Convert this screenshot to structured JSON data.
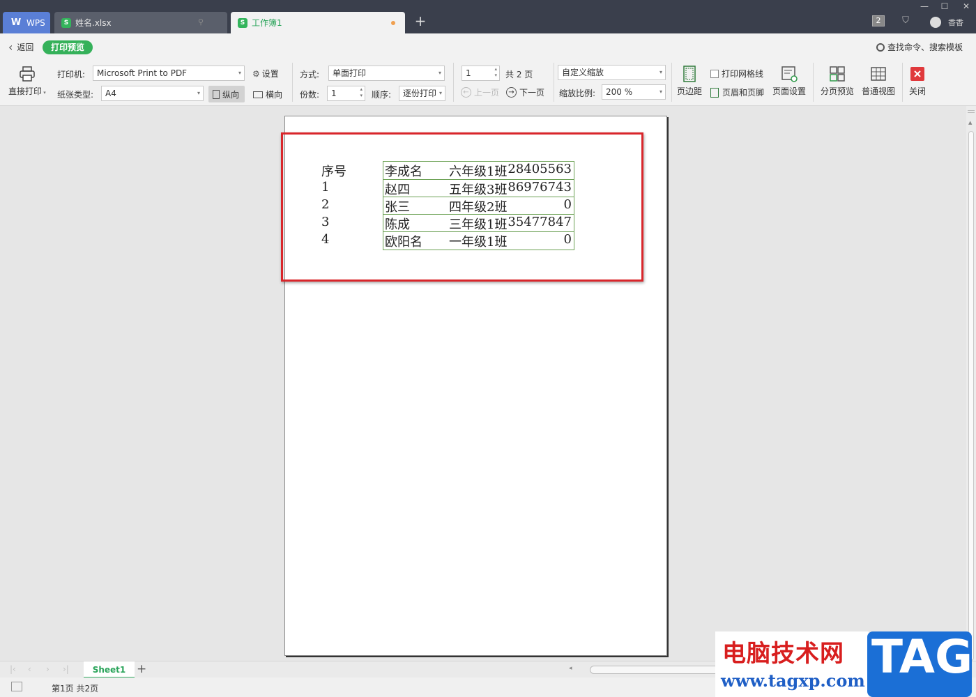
{
  "window": {
    "tabs": [
      {
        "label": "WPS",
        "icon": "wps-logo-icon"
      },
      {
        "label": "姓名.xlsx",
        "icon": "spreadsheet-icon"
      },
      {
        "label": "工作簿1",
        "icon": "spreadsheet-icon",
        "active": true
      }
    ],
    "new_tab_label": "+",
    "tab_count_badge": "2",
    "user_name": "香香",
    "minimize": "—",
    "maximize": "☐",
    "close": "✕"
  },
  "header": {
    "back_label": "返回",
    "mode_label": "打印预览",
    "search_label": "查找命令、搜索模板"
  },
  "toolbar": {
    "direct_print": "直接打印",
    "printer_label": "打印机:",
    "printer_value": "Microsoft Print to PDF",
    "settings": "设置",
    "paper_label": "纸张类型:",
    "paper_value": "A4",
    "portrait": "纵向",
    "landscape": "横向",
    "method_label": "方式:",
    "method_value": "单面打印",
    "copies_label": "份数:",
    "copies_value": "1",
    "order_label": "顺序:",
    "order_value": "逐份打印",
    "page_input": "1",
    "total_pages": "共 2 页",
    "prev_page": "上一页",
    "next_page": "下一页",
    "scale_mode": "自定义缩放",
    "scale_label": "缩放比例:",
    "scale_value": "200 %",
    "margins": "页边距",
    "print_gridlines": "打印网格线",
    "header_footer": "页眉和页脚",
    "page_setup": "页面设置",
    "page_break_preview": "分页预览",
    "normal_view": "普通视图",
    "close": "关闭"
  },
  "sheet": {
    "rows": [
      {
        "idx": "序号",
        "name": "李成名",
        "class": "六年级1班",
        "num": "28405563"
      },
      {
        "idx": "1",
        "name": "赵四",
        "class": "五年级3班",
        "num": "86976743"
      },
      {
        "idx": "2",
        "name": "张三",
        "class": "四年级2班",
        "num": "0"
      },
      {
        "idx": "3",
        "name": "陈成",
        "class": "三年级1班",
        "num": "35477847"
      },
      {
        "idx": "4",
        "name": "欧阳名",
        "class": "一年级1班",
        "num": "0"
      }
    ]
  },
  "sheetbar": {
    "sheet_tab": "Sheet1",
    "add_sheet": "+"
  },
  "status": {
    "page_info": "第1页 共2页"
  },
  "watermark": {
    "title": "电脑技术网",
    "url": "www.tagxp.com",
    "tag": "TAG"
  },
  "colors": {
    "accent_green": "#35b15a",
    "highlight_red": "#d9262b",
    "titlebar": "#3a3f4c"
  }
}
